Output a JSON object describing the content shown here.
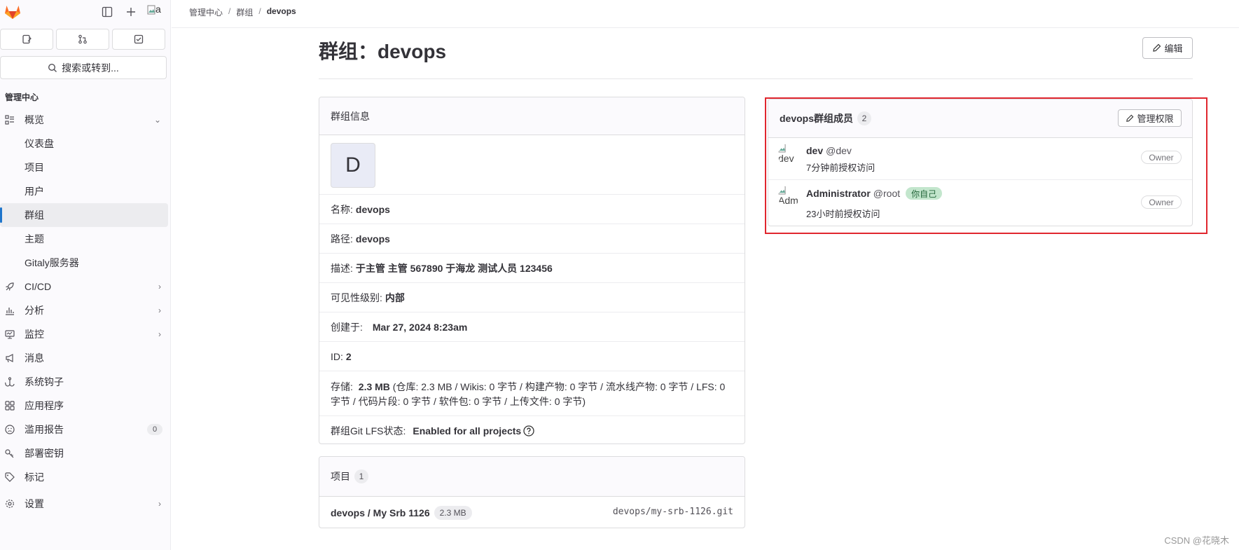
{
  "sidebar": {
    "avatar_alt": "a",
    "tabs": [
      "issues",
      "merge-requests",
      "todos"
    ],
    "search_label": "搜索或转到...",
    "section_title": "管理中心",
    "items": [
      {
        "label": "概览",
        "icon": "overview-icon",
        "expand": "down"
      },
      {
        "label": "仪表盘"
      },
      {
        "label": "项目"
      },
      {
        "label": "用户"
      },
      {
        "label": "群组",
        "active": true
      },
      {
        "label": "主题"
      },
      {
        "label": "Gitaly服务器"
      },
      {
        "label": "CI/CD",
        "icon": "rocket-icon",
        "expand": "right"
      },
      {
        "label": "分析",
        "icon": "chart-icon",
        "expand": "right"
      },
      {
        "label": "监控",
        "icon": "monitor-icon",
        "expand": "right"
      },
      {
        "label": "消息",
        "icon": "bullhorn-icon"
      },
      {
        "label": "系统钩子",
        "icon": "hook-icon"
      },
      {
        "label": "应用程序",
        "icon": "apps-icon"
      },
      {
        "label": "滥用报告",
        "icon": "abuse-icon",
        "badge": "0"
      },
      {
        "label": "部署密钥",
        "icon": "key-icon"
      },
      {
        "label": "标记",
        "icon": "label-icon"
      },
      {
        "label": "设置",
        "icon": "gear-icon",
        "expand": "right"
      }
    ]
  },
  "breadcrumb": {
    "items": [
      "管理中心",
      "群组",
      "devops"
    ]
  },
  "page": {
    "title": "群组：devops",
    "edit_label": "编辑"
  },
  "group_info": {
    "header": "群组信息",
    "avatar_letter": "D",
    "name_label": "名称:",
    "name": "devops",
    "path_label": "路径:",
    "path": "devops",
    "desc_label": "描述:",
    "desc": "于主管 主管 567890 于海龙 测试人员 123456",
    "visibility_label": "可见性级别:",
    "visibility": "内部",
    "created_label": "创建于:",
    "created": "Mar 27, 2024 8:23am",
    "id_label": "ID:",
    "id": "2",
    "storage_label": "存储:",
    "storage_total": "2.3 MB",
    "storage_detail": "(仓库: 2.3 MB / Wikis: 0 字节 / 构建产物: 0 字节 / 流水线产物: 0 字节 / LFS: 0 字节 / 代码片段: 0 字节 / 软件包: 0 字节 / 上传文件: 0 字节)",
    "lfs_label": "群组Git LFS状态:",
    "lfs": "Enabled for all projects"
  },
  "projects": {
    "header": "项目",
    "count": "1",
    "items": [
      {
        "name": "devops / My Srb 1126",
        "size": "2.3 MB",
        "path": "devops/my-srb-1126.git"
      }
    ]
  },
  "members": {
    "header": "devops群组成员",
    "count": "2",
    "manage_label": "管理权限",
    "items": [
      {
        "avatar_alt": "dev",
        "name": "dev",
        "username": "@dev",
        "granted": "7分钟前授权访问",
        "role": "Owner"
      },
      {
        "avatar_alt": "Adm",
        "name": "Administrator",
        "username": "@root",
        "self": "你自己",
        "granted": "23小时前授权访问",
        "role": "Owner"
      }
    ]
  },
  "watermark": "CSDN @花晓木",
  "colors": {
    "accent": "#1f75cb",
    "highlight": "#e0262e",
    "logo": "#fc6d26"
  }
}
